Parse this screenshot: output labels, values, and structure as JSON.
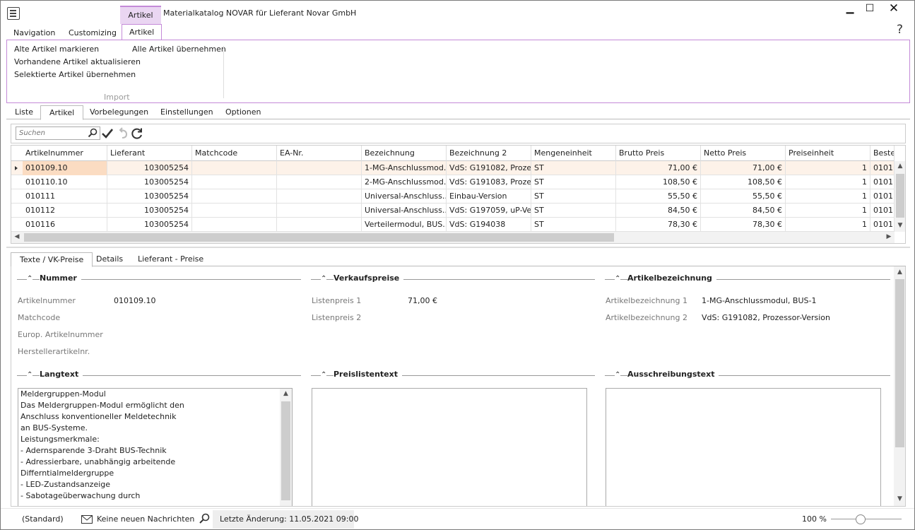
{
  "window": {
    "title": "Materialkatalog NOVAR für Lieferant Novar GmbH",
    "context_tab": "Artikel",
    "min_glyph": "▁",
    "max_glyph": "☐",
    "close_glyph": "✕",
    "help_glyph": "?"
  },
  "ribbon": {
    "tabs": [
      "Navigation",
      "Customizing",
      "Artikel"
    ],
    "buttons": [
      "Alte Artikel markieren",
      "Vorhandene Artikel aktualisieren",
      "Selektierte Artikel übernehmen",
      "Alle Artikel übernehmen"
    ],
    "group_label": "Import"
  },
  "view_tabs": [
    "Liste",
    "Artikel",
    "Vorbelegungen",
    "Einstellungen",
    "Optionen"
  ],
  "toolbar": {
    "search_placeholder": "Suchen",
    "icons": [
      "search-icon",
      "check-icon",
      "undo-icon",
      "refresh-icon"
    ]
  },
  "grid": {
    "columns": [
      "Artikelnummer",
      "Lieferant",
      "Matchcode",
      "EA-Nr.",
      "Bezeichnung",
      "Bezeichnung 2",
      "Mengeneinheit",
      "Brutto Preis",
      "Netto Preis",
      "Preiseinheit",
      "Beste"
    ],
    "rows": [
      [
        "010109.10",
        "103005254",
        "",
        "",
        "1-MG-Anschlussmod...",
        "VdS: G191082, Proze...",
        "ST",
        "71,00 €",
        "71,00 €",
        "1",
        "0101("
      ],
      [
        "010110.10",
        "103005254",
        "",
        "",
        "2-MG-Anschlussmod...",
        "VdS: G191083, Proze...",
        "ST",
        "108,50 €",
        "108,50 €",
        "1",
        "01011"
      ],
      [
        "010111",
        "103005254",
        "",
        "",
        "Universal-Anschluss...",
        "Einbau-Version",
        "ST",
        "55,50 €",
        "55,50 €",
        "1",
        "01011"
      ],
      [
        "010112",
        "103005254",
        "",
        "",
        "Universal-Anschluss...",
        "VdS: G197059, uP-Ve...",
        "ST",
        "84,50 €",
        "84,50 €",
        "1",
        "01011"
      ],
      [
        "010116",
        "103005254",
        "",
        "",
        "Verteilermodul,  BUS...",
        "VdS: G194038",
        "ST",
        "78,30 €",
        "78,30 €",
        "1",
        "01011"
      ]
    ]
  },
  "detail_tabs": [
    "Texte / VK-Preise",
    "Details",
    "Lieferant - Preise"
  ],
  "detail": {
    "nummer": {
      "title": "Nummer",
      "labels": [
        "Artikelnummer",
        "Matchcode",
        "Europ. Artikelnummer",
        "Herstellerartikelnr."
      ],
      "values": [
        "010109.10",
        "",
        "",
        ""
      ]
    },
    "verkaufspreise": {
      "title": "Verkaufspreise",
      "labels": [
        "Listenpreis 1",
        "Listenpreis 2"
      ],
      "values": [
        "71,00 €",
        ""
      ]
    },
    "artikelbezeichnung": {
      "title": "Artikelbezeichnung",
      "labels": [
        "Artikelbezeichnung 1",
        "Artikelbezeichnung 2"
      ],
      "values": [
        "1-MG-Anschlussmodul, BUS-1",
        "VdS: G191082, Prozessor-Version"
      ]
    },
    "langtext": {
      "title": "Langtext",
      "lines": [
        "Meldergruppen-Modul",
        "Das Meldergruppen-Modul ermöglicht den",
        "Anschluss konventioneller Meldetechnik",
        "an BUS-Systeme.",
        "Leistungsmerkmale:",
        "- Adernsparende 3-Draht BUS-Technik",
        "- Adressierbare, unabhängig arbeitende",
        "Differntialmeldergruppe",
        "- LED-Zustandsanzeige",
        "- Sabotageüberwachung durch"
      ]
    },
    "preislistentext": {
      "title": "Preislistentext"
    },
    "ausschreibungstext": {
      "title": "Ausschreibungstext"
    }
  },
  "status": {
    "profile": "(Standard)",
    "messages": "Keine neuen Nachrichten",
    "last_change": "Letzte Änderung: 11.05.2021 09:00",
    "zoom": "100 %",
    "zoom_level": 0.42
  }
}
